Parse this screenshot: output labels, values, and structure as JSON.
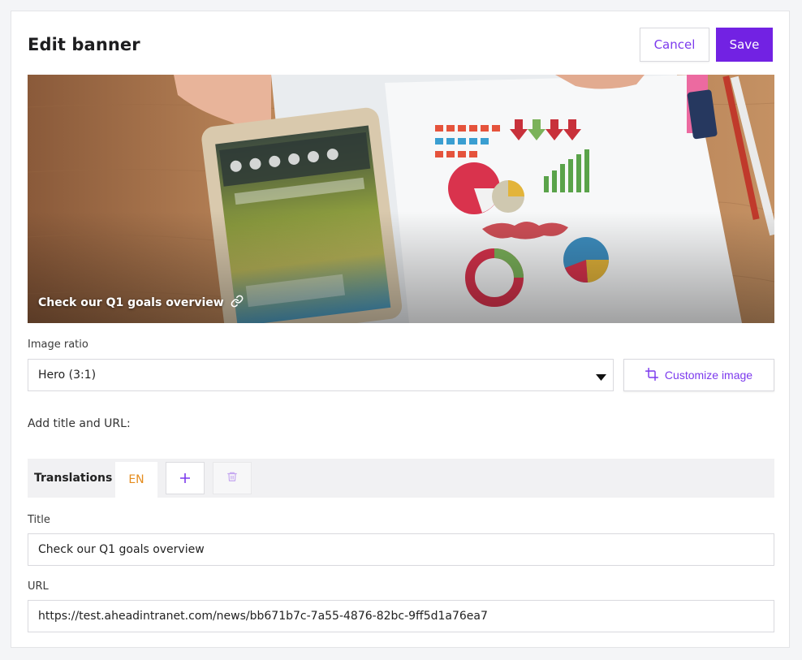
{
  "header": {
    "title": "Edit banner",
    "cancel_label": "Cancel",
    "save_label": "Save"
  },
  "banner": {
    "caption": "Check our Q1 goals overview",
    "icon": "link-icon"
  },
  "image_ratio": {
    "label": "Image ratio",
    "selected": "Hero (3:1)",
    "customize_label": "Customize image",
    "customize_icon": "crop-icon"
  },
  "section": {
    "add_title_url": "Add title and URL:"
  },
  "translations": {
    "label": "Translations",
    "tabs": [
      {
        "label": "EN"
      }
    ],
    "add_icon": "plus-icon",
    "delete_icon": "trash-icon"
  },
  "form": {
    "title_label": "Title",
    "title_value": "Check our Q1 goals overview",
    "url_label": "URL",
    "url_value": "https://test.aheadintranet.com/news/bb671b7c-7a55-4876-82bc-9ff5d1a76ea7"
  },
  "colors": {
    "accent": "#7222e3",
    "accent_text": "#7c3aed",
    "tab_active_text": "#e58c1e"
  }
}
